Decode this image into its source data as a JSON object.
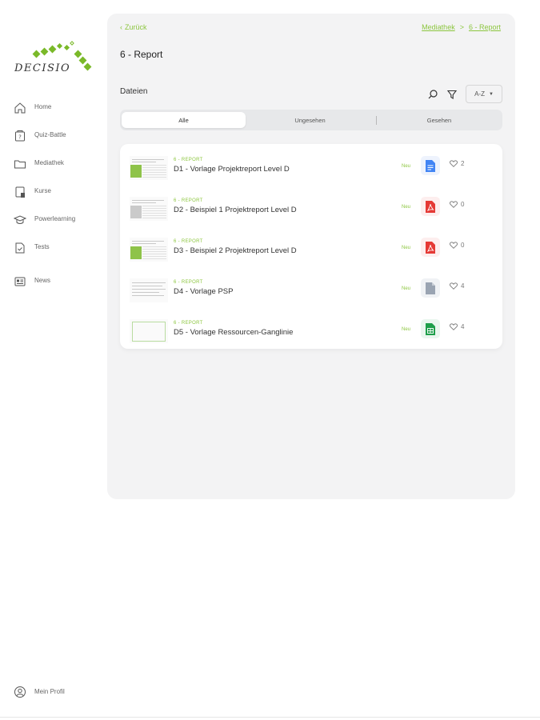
{
  "brand": {
    "name": "DECISIO",
    "color": "#7ab929"
  },
  "sidebar": {
    "items": [
      {
        "label": "Home",
        "icon": "home-icon"
      },
      {
        "label": "Quiz-Battle",
        "icon": "quiz-icon"
      },
      {
        "label": "Mediathek",
        "icon": "folder-icon"
      },
      {
        "label": "Kurse",
        "icon": "course-icon"
      },
      {
        "label": "Powerlearning",
        "icon": "graduation-cap-icon"
      },
      {
        "label": "Tests",
        "icon": "test-icon"
      },
      {
        "label": "News",
        "icon": "news-icon"
      }
    ],
    "profile": {
      "label": "Mein Profil",
      "icon": "user-icon"
    }
  },
  "header": {
    "back_label": "Zurück",
    "breadcrumb": [
      "Mediathek",
      "6 - Report"
    ],
    "breadcrumb_separator": ">"
  },
  "page": {
    "title": "6 - Report",
    "section_title": "Dateien",
    "sort_value": "A-Z"
  },
  "tabs": [
    {
      "label": "Alle",
      "active": true
    },
    {
      "label": "Ungesehen",
      "active": false
    },
    {
      "label": "Gesehen",
      "active": false
    }
  ],
  "files": [
    {
      "category": "6 - REPORT",
      "title": "D1 - Vorlage Projektreport Level D",
      "badge": "Neu",
      "type": "doc",
      "likes": "2"
    },
    {
      "category": "6 - REPORT",
      "title": "D2 - Beispiel 1 Projektreport Level D",
      "badge": "Neu",
      "type": "pdf",
      "likes": "0"
    },
    {
      "category": "6 - REPORT",
      "title": "D3 - Beispiel 2 Projektreport Level D",
      "badge": "Neu",
      "type": "pdf",
      "likes": "0"
    },
    {
      "category": "6 - REPORT",
      "title": "D4 - Vorlage PSP",
      "badge": "Neu",
      "type": "file",
      "likes": "4"
    },
    {
      "category": "6 - REPORT",
      "title": "D5 - Vorlage Ressourcen-Ganglinie",
      "badge": "Neu",
      "type": "sheet",
      "likes": "4"
    }
  ],
  "colors": {
    "accent": "#8cc63f",
    "doc": "#4285f4",
    "pdf": "#e53935",
    "file": "#9aa4b2",
    "sheet": "#1e9e4a"
  }
}
